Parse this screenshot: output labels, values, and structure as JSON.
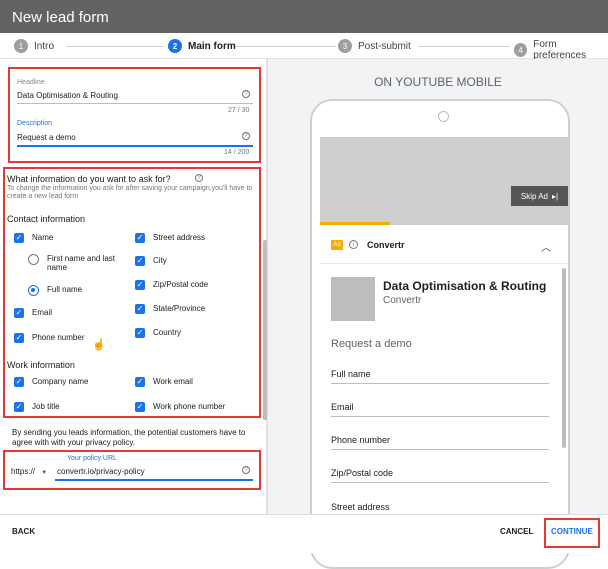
{
  "window": {
    "title": "New lead form"
  },
  "stepper": {
    "steps": [
      {
        "num": "1",
        "label": "Intro"
      },
      {
        "num": "2",
        "label": "Main form"
      },
      {
        "num": "3",
        "label": "Post-submit"
      },
      {
        "num": "4",
        "label": "Form preferences"
      }
    ]
  },
  "form": {
    "headline_label": "Headline",
    "headline_value": "Data Optimisation & Routing",
    "headline_counter": "27 / 30",
    "description_label": "Description",
    "description_value": "Request a demo",
    "description_counter": "14 / 200",
    "question_title": "What information do you want to ask for?",
    "question_hint": "To change the information you ask for after saving your campaign,you'll have to create a new lead form",
    "contact_title": "Contact information",
    "contact": {
      "name": "Name",
      "first_last": "First name and last name",
      "full_name": "Full name",
      "email": "Email",
      "phone": "Phone number",
      "street": "Street address",
      "city": "City",
      "zip": "Zip/Postal code",
      "state": "State/Province",
      "country": "Country"
    },
    "work_title": "Work information",
    "work": {
      "company": "Company name",
      "job": "Job title",
      "work_email": "Work email",
      "work_phone": "Work phone number"
    },
    "consent_text": "By sending you leads information, the potential customers have to agree with with your privacy policy.",
    "policy_label": "Your policy URL",
    "protocol": "https://",
    "policy_url": "convertr.io/privacy-policy"
  },
  "preview": {
    "header": "ON YOUTUBE MOBILE",
    "skip_ad": "Skip Ad",
    "ad_badge": "Ad",
    "advertiser": "Convertr",
    "headline": "Data Optimisation & Routing",
    "subtitle": "Convertr",
    "description": "Request a demo",
    "fields": [
      "Full name",
      "Email",
      "Phone number",
      "Zip/Postal code",
      "Street address"
    ]
  },
  "footer": {
    "back": "BACK",
    "cancel": "CANCEL",
    "continue": "CONTINUE"
  },
  "colors": {
    "accent": "#1a73e8",
    "highlight": "#e53935",
    "ad_badge": "#f9ab00"
  }
}
